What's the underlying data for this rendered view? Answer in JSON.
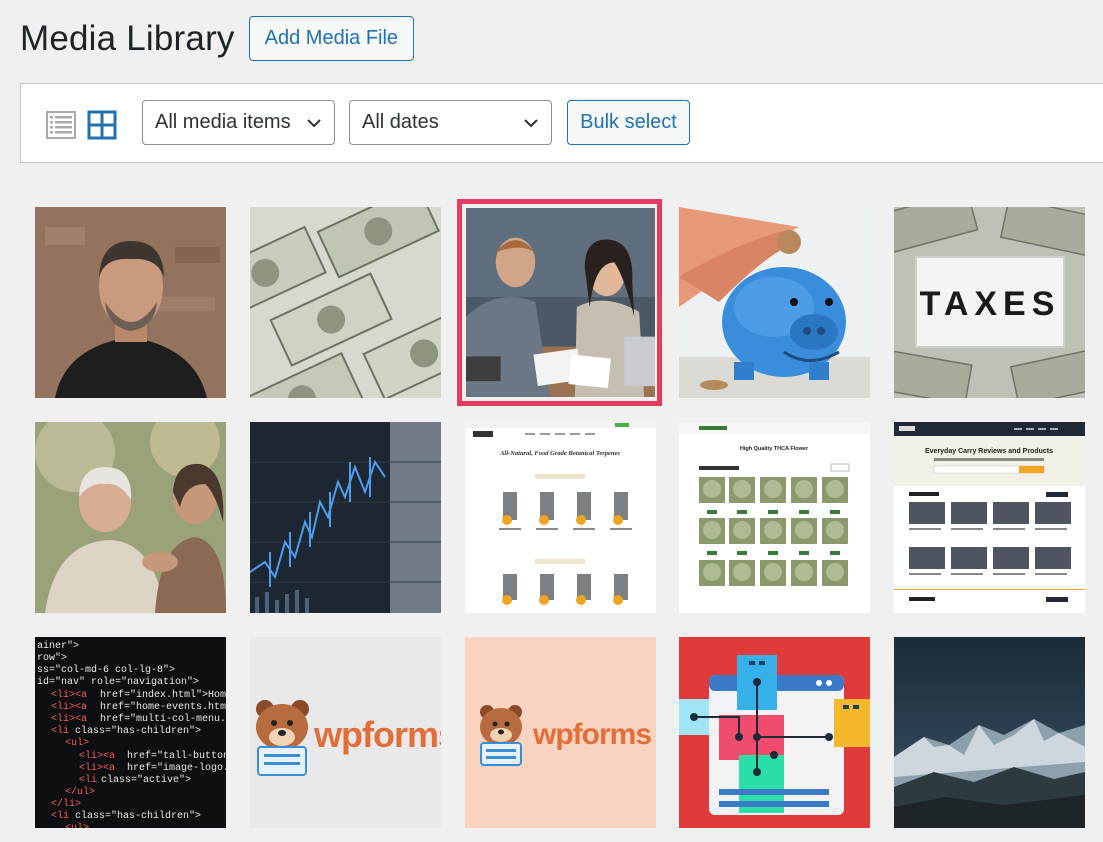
{
  "header": {
    "title": "Media Library",
    "add_button_label": "Add Media File"
  },
  "toolbar": {
    "list_view_icon": "list-view-icon",
    "grid_view_icon": "grid-view-icon",
    "type_filter": {
      "selected": "All media items"
    },
    "date_filter": {
      "selected": "All dates"
    },
    "bulk_select_label": "Bulk select"
  },
  "colors": {
    "accent": "#2271b1",
    "selection": "#e43c5f",
    "background": "#f0f0f1"
  },
  "media_items": [
    {
      "subject": "man-portrait",
      "selected": false
    },
    {
      "subject": "dollar-bills",
      "selected": false
    },
    {
      "subject": "couple-reviewing-bills",
      "selected": true
    },
    {
      "subject": "piggy-bank-coin",
      "selected": false
    },
    {
      "subject": "taxes-lightbox",
      "selected": false,
      "text": "TAXES"
    },
    {
      "subject": "elderly-woman-and-caregiver",
      "selected": false
    },
    {
      "subject": "stock-chart",
      "selected": false
    },
    {
      "subject": "terpenes-website-screenshot",
      "selected": false,
      "text": "All-Natural, Food Grade Botanical Terpenes"
    },
    {
      "subject": "thca-flower-website-screenshot",
      "selected": false,
      "text": "High Quality THCA Flower"
    },
    {
      "subject": "reviews-website-screenshot",
      "selected": false,
      "text": "Everyday Carry Reviews and Products"
    },
    {
      "subject": "html-code",
      "selected": false
    },
    {
      "subject": "wpforms-logo-gray",
      "selected": false,
      "text": "wpforms"
    },
    {
      "subject": "wpforms-logo-peach",
      "selected": false,
      "text": "wpforms"
    },
    {
      "subject": "sitemap-illustration",
      "selected": false
    },
    {
      "subject": "mountain-landscape",
      "selected": false
    }
  ]
}
